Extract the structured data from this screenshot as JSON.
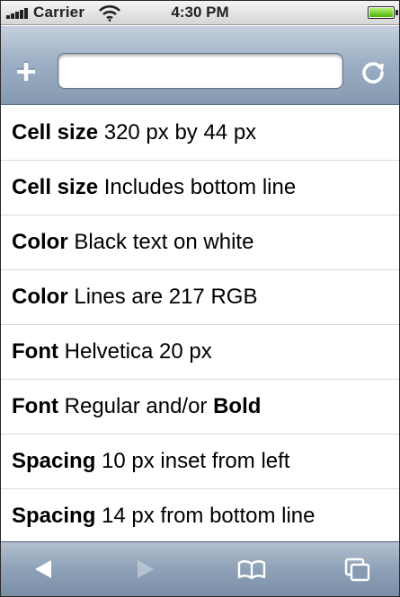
{
  "status_bar": {
    "carrier": "Carrier",
    "time": "4:30 PM",
    "battery_level": 1.0,
    "signal_bars": 5,
    "battery_color": "#48b400"
  },
  "nav_bar": {
    "add_icon": "plus-icon",
    "url_value": "",
    "url_placeholder": "",
    "reload_icon": "reload-icon"
  },
  "list": {
    "items": [
      {
        "key": "Cell size",
        "text": " 320 px by 44 px",
        "suffix_bold": ""
      },
      {
        "key": "Cell size",
        "text": " Includes bottom line",
        "suffix_bold": ""
      },
      {
        "key": "Color",
        "text": " Black text on white",
        "suffix_bold": ""
      },
      {
        "key": "Color",
        "text": " Lines are 217 RGB",
        "suffix_bold": ""
      },
      {
        "key": "Font",
        "text": " Helvetica 20 px",
        "suffix_bold": ""
      },
      {
        "key": "Font",
        "text": " Regular and/or ",
        "suffix_bold": "Bold"
      },
      {
        "key": "Spacing",
        "text": " 10 px inset from left",
        "suffix_bold": ""
      },
      {
        "key": "Spacing",
        "text": " 14 px from bottom line",
        "suffix_bold": ""
      }
    ]
  },
  "toolbar": {
    "buttons": [
      "back-icon",
      "forward-icon",
      "bookmarks-icon",
      "pages-icon"
    ]
  }
}
